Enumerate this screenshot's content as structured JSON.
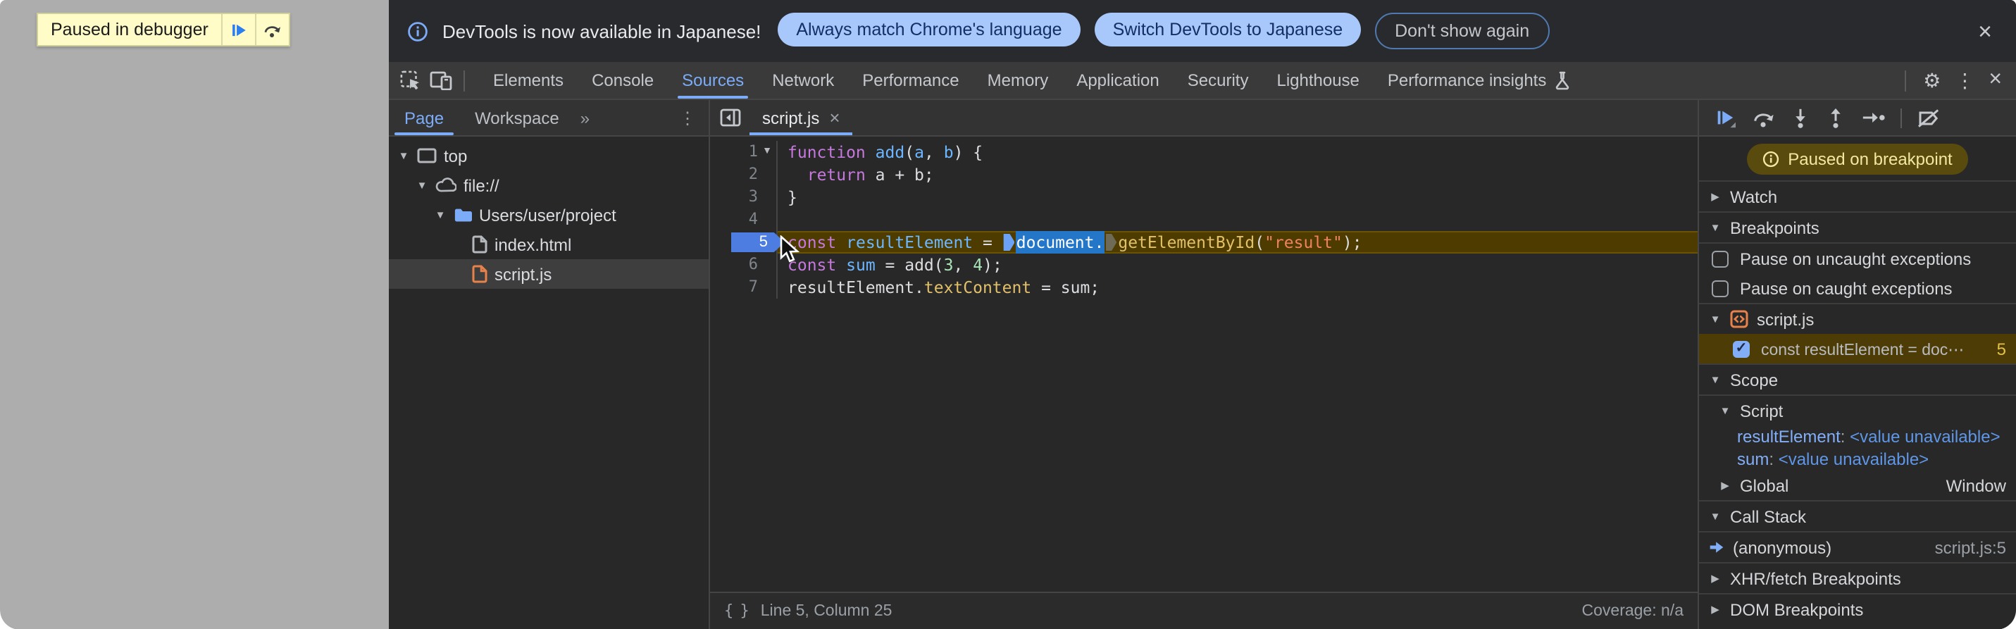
{
  "colors": {
    "accent_blue": "#7cacf8",
    "page_background": "#adadad",
    "panel_background": "#282828",
    "toolbar_background": "#333333",
    "infobar_button_bg": "#a8c7fa",
    "paused_badge_bg": "#594a0e",
    "paused_badge_text": "#f2e8a0",
    "exec_line_bg": "#4d3b00",
    "selection_blue": "#2476c9",
    "js_file_orange": "#e8824b",
    "overlay_yellow": "#fffcc8"
  },
  "page": {
    "paused_overlay_label": "Paused in debugger"
  },
  "infobar": {
    "message": "DevTools is now available in Japanese!",
    "actions": [
      {
        "label": "Always match Chrome's language",
        "style": "filled"
      },
      {
        "label": "Switch DevTools to Japanese",
        "style": "filled"
      },
      {
        "label": "Don't show again",
        "style": "outline"
      }
    ],
    "close_glyph": "×"
  },
  "main_toolbar": {
    "active_tab": "Sources",
    "tabs": [
      {
        "label": "Elements"
      },
      {
        "label": "Console"
      },
      {
        "label": "Sources"
      },
      {
        "label": "Network"
      },
      {
        "label": "Performance"
      },
      {
        "label": "Memory"
      },
      {
        "label": "Application"
      },
      {
        "label": "Security"
      },
      {
        "label": "Lighthouse"
      },
      {
        "label": "Performance insights",
        "icon": "flask"
      }
    ],
    "close_glyph": "×"
  },
  "sources_sidebar": {
    "tabs": [
      "Page",
      "Workspace"
    ],
    "active_tab": "Page",
    "overflow_chevrons": "»",
    "tree": [
      {
        "label": "top",
        "icon": "frame",
        "depth": 0,
        "expanded": true
      },
      {
        "label": "file://",
        "icon": "cloud",
        "depth": 1,
        "expanded": true
      },
      {
        "label": "Users/user/project",
        "icon": "folder",
        "depth": 2,
        "expanded": true
      },
      {
        "label": "index.html",
        "icon": "file-html",
        "depth": 3
      },
      {
        "label": "script.js",
        "icon": "file-js",
        "depth": 3,
        "selected": true
      }
    ]
  },
  "editor": {
    "open_tab": "script.js",
    "close_glyph": "×",
    "paused_line": 5,
    "lines": [
      {
        "number": 1,
        "fold": true,
        "tokens": [
          {
            "t": "function",
            "c": "kw"
          },
          {
            "t": " ",
            "c": "pl"
          },
          {
            "t": "add",
            "c": "def"
          },
          {
            "t": "(",
            "c": "pl"
          },
          {
            "t": "a",
            "c": "def"
          },
          {
            "t": ", ",
            "c": "pl"
          },
          {
            "t": "b",
            "c": "def"
          },
          {
            "t": ") {",
            "c": "pl"
          }
        ]
      },
      {
        "number": 2,
        "tokens": [
          {
            "t": "  ",
            "c": "pl"
          },
          {
            "t": "return",
            "c": "kw"
          },
          {
            "t": " a + b;",
            "c": "pl"
          }
        ]
      },
      {
        "number": 3,
        "tokens": [
          {
            "t": "}",
            "c": "pl"
          }
        ]
      },
      {
        "number": 4,
        "tokens": []
      },
      {
        "number": 5,
        "tokens": [
          {
            "t": "const",
            "c": "kw"
          },
          {
            "t": " ",
            "c": "pl"
          },
          {
            "t": "resultElement",
            "c": "def"
          },
          {
            "t": " = ",
            "c": "pl"
          },
          {
            "t": "",
            "c": "m-exec"
          },
          {
            "t": "document.",
            "c": "sel"
          },
          {
            "t": "",
            "c": "m-cont"
          },
          {
            "t": "getElementById",
            "c": "prop"
          },
          {
            "t": "(",
            "c": "pl"
          },
          {
            "t": "\"result\"",
            "c": "str"
          },
          {
            "t": ");",
            "c": "pl"
          }
        ]
      },
      {
        "number": 6,
        "tokens": [
          {
            "t": "const",
            "c": "kw"
          },
          {
            "t": " ",
            "c": "pl"
          },
          {
            "t": "sum",
            "c": "def"
          },
          {
            "t": " = add(",
            "c": "pl"
          },
          {
            "t": "3",
            "c": "num"
          },
          {
            "t": ", ",
            "c": "pl"
          },
          {
            "t": "4",
            "c": "num"
          },
          {
            "t": ");",
            "c": "pl"
          }
        ]
      },
      {
        "number": 7,
        "tokens": [
          {
            "t": "resultElement.",
            "c": "pl"
          },
          {
            "t": "textContent",
            "c": "prop"
          },
          {
            "t": " = sum;",
            "c": "pl"
          }
        ]
      }
    ],
    "status_bar": {
      "braces_icon": "{ }",
      "position": "Line 5, Column 25",
      "coverage": "Coverage: n/a"
    }
  },
  "debugger_pane": {
    "toolbar_buttons": [
      "resume",
      "step-over",
      "step-into",
      "step-out",
      "step",
      "deactivate-breakpoints"
    ],
    "paused_badge": "Paused on breakpoint",
    "rows": [
      {
        "type": "header",
        "label": "Watch",
        "arrow": "right",
        "top_border": true
      },
      {
        "type": "header",
        "label": "Breakpoints",
        "arrow": "down",
        "top_border": true,
        "bottom_border": true
      },
      {
        "type": "checkbox",
        "label": "Pause on uncaught exceptions",
        "checked": false
      },
      {
        "type": "checkbox",
        "label": "Pause on caught exceptions",
        "checked": false,
        "bottom_border": true
      },
      {
        "type": "group",
        "label": "script.js",
        "arrow": "down",
        "icon": "snippet"
      },
      {
        "type": "breakpoint",
        "label": "const resultElement = doc⋯",
        "line": "5",
        "checked": true
      },
      {
        "type": "header",
        "label": "Scope",
        "arrow": "down",
        "top_border": true,
        "bottom_border": true
      },
      {
        "type": "subheader",
        "label": "Script",
        "arrow": "down"
      },
      {
        "type": "variable",
        "name": "resultElement",
        "value": "<value unavailable>"
      },
      {
        "type": "variable",
        "name": "sum",
        "value": "<value unavailable>"
      },
      {
        "type": "subheader",
        "label": "Global",
        "arrow": "right",
        "right": "Window"
      },
      {
        "type": "header",
        "label": "Call Stack",
        "arrow": "down",
        "top_border": true,
        "bottom_border": true
      },
      {
        "type": "callframe",
        "label": "(anonymous)",
        "right": "script.js:5"
      },
      {
        "type": "header",
        "label": "XHR/fetch Breakpoints",
        "arrow": "right",
        "top_border": true
      },
      {
        "type": "header",
        "label": "DOM Breakpoints",
        "arrow": "right",
        "top_border": true
      }
    ]
  }
}
